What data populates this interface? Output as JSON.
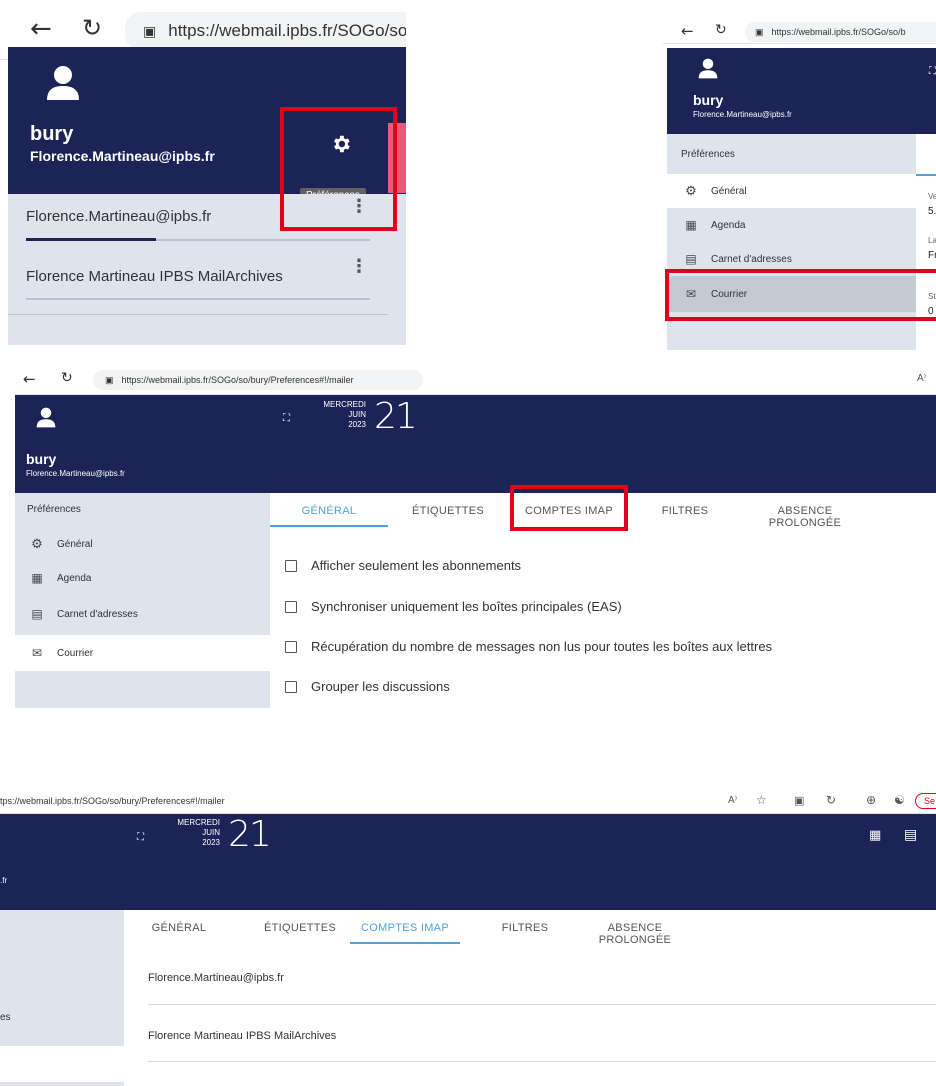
{
  "browser": {
    "url_short": "https://webmail.ipbs.fr/SOGo/so/",
    "url_short2": "https://webmail.ipbs.fr/SOGo/so/b",
    "url_full": "https://webmail.ipbs.fr/SOGo/so/bury/Preferences#!/mailer",
    "url_cut": "tps://webmail.ipbs.fr/SOGo/so/bury/Preferences#!/mailer",
    "reader_label": "A⁾",
    "sign_in_partial": "Se"
  },
  "user": {
    "name": "bury",
    "email": "Florence.Martineau@ipbs.fr",
    "email_cut": ".fr"
  },
  "panel1": {
    "tooltip": "Préférences",
    "accounts": [
      "Florence.Martineau@ipbs.fr",
      "Florence Martineau IPBS MailArchives"
    ]
  },
  "sidebar": {
    "title": "Préférences",
    "items": [
      "Général",
      "Agenda",
      "Carnet d'adresses",
      "Courrier"
    ],
    "cut_item": "es"
  },
  "panel2_partial": {
    "lines": [
      "Ve",
      "5.",
      "La",
      "Fr",
      "St",
      "0"
    ]
  },
  "date": {
    "weekday": "MERCREDI",
    "month": "JUIN",
    "year": "2023",
    "day": "21"
  },
  "tabs": [
    "GÉNÉRAL",
    "ÉTIQUETTES",
    "COMPTES IMAP",
    "FILTRES",
    "ABSENCE PROLONGÉE"
  ],
  "options": [
    "Afficher seulement les abonnements",
    "Synchroniser uniquement les boîtes principales (EAS)",
    "Récupération du nombre de messages non lus pour toutes les boîtes aux lettres",
    "Grouper les discussions"
  ],
  "imap_accounts": [
    "Florence.Martineau@ipbs.fr",
    "Florence Martineau IPBS MailArchives"
  ],
  "icons": {
    "back": "back-arrow-icon",
    "reload": "reload-icon",
    "lock": "lock-icon",
    "user": "user-avatar-icon",
    "gear": "gear-icon",
    "calendar": "calendar-icon",
    "contacts": "address-book-icon",
    "mail": "mail-icon",
    "fullscreen": "fullscreen-icon",
    "more": "more-vert-icon"
  },
  "colors": {
    "navy": "#1c2357",
    "highlight_red": "#e2001a",
    "active_tab": "#4fa3d9",
    "sidebar_bg": "#dfe3ec"
  }
}
